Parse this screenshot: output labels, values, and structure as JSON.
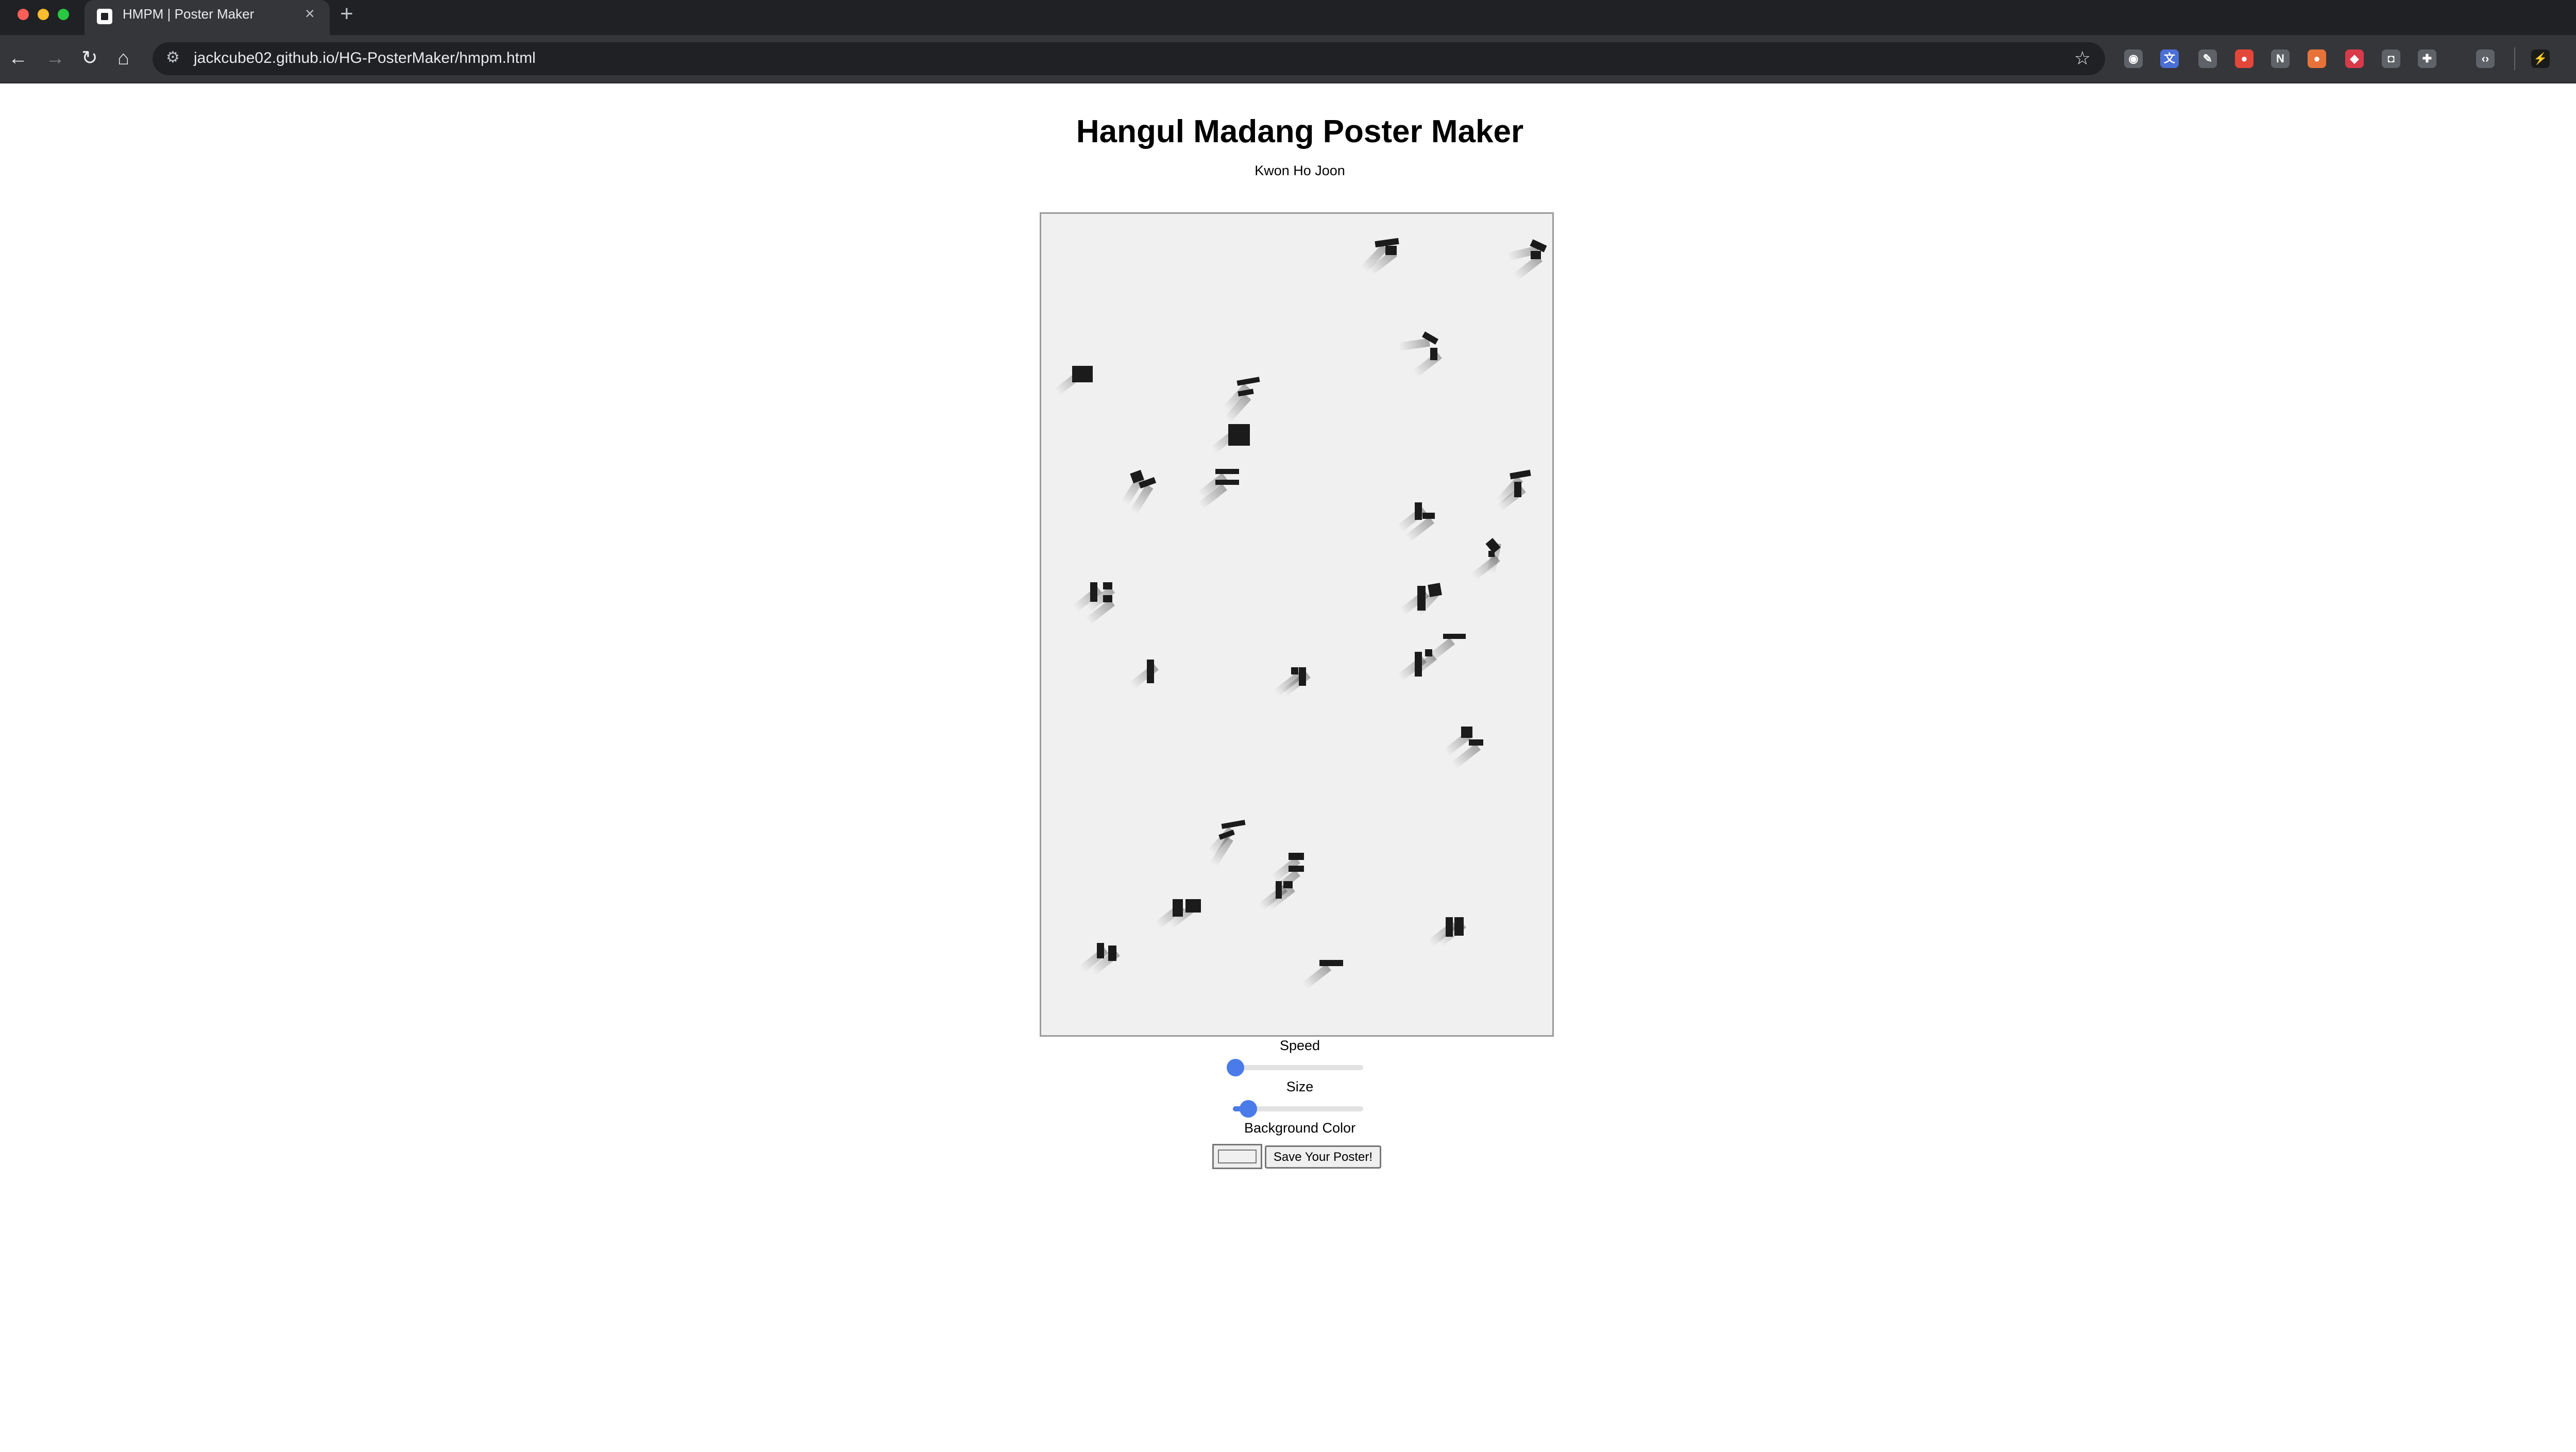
{
  "browser": {
    "tab_title": "HMPM | Poster Maker",
    "tab_close_icon": "×",
    "new_tab_icon": "+",
    "tab_menu_icon": "⌄",
    "back_icon": "←",
    "forward_icon": "→",
    "reload_icon": "↻",
    "home_icon": "⌂",
    "site_info_icon": "⚙",
    "url": "jackcube02.github.io/HG-PosterMaker/hmpm.html",
    "bookmark_icon": "☆",
    "extensions": [
      {
        "icon": "screenshot-icon",
        "glyph": "◉",
        "color": "#5f6368"
      },
      {
        "icon": "translate-icon",
        "glyph": "文",
        "color": "#4a6fd8"
      },
      {
        "icon": "pen-icon",
        "glyph": "✎",
        "color": "#5f6368"
      },
      {
        "icon": "flame-icon",
        "glyph": "●",
        "color": "#e2473a"
      },
      {
        "icon": "notion-icon",
        "glyph": "N",
        "color": "#5f6368"
      },
      {
        "icon": "fox-icon",
        "glyph": "●",
        "color": "#e8733a"
      },
      {
        "icon": "shield-icon",
        "glyph": "◆",
        "color": "#d93a4a"
      },
      {
        "icon": "camera-icon",
        "glyph": "◘",
        "color": "#5f6368"
      },
      {
        "icon": "puzzle-icon",
        "glyph": "✚",
        "color": "#5f6368"
      },
      {
        "icon": "code-icon",
        "glyph": "‹›",
        "color": "#5f6368"
      },
      {
        "icon": "profile-icon",
        "glyph": "⚡",
        "color": "#1a1a1a"
      }
    ],
    "menu_icon": "⋮"
  },
  "page": {
    "title": "Hangul Madang Poster Maker",
    "author": "Kwon Ho Joon",
    "poster_background": "#f0f0f0",
    "controls": {
      "speed_label": "Speed",
      "speed_value": 0.02,
      "size_label": "Size",
      "size_value": 0.12,
      "background_color_label": "Background Color",
      "background_color_value": "#f0f0f0",
      "save_label": "Save Your Poster!"
    }
  }
}
